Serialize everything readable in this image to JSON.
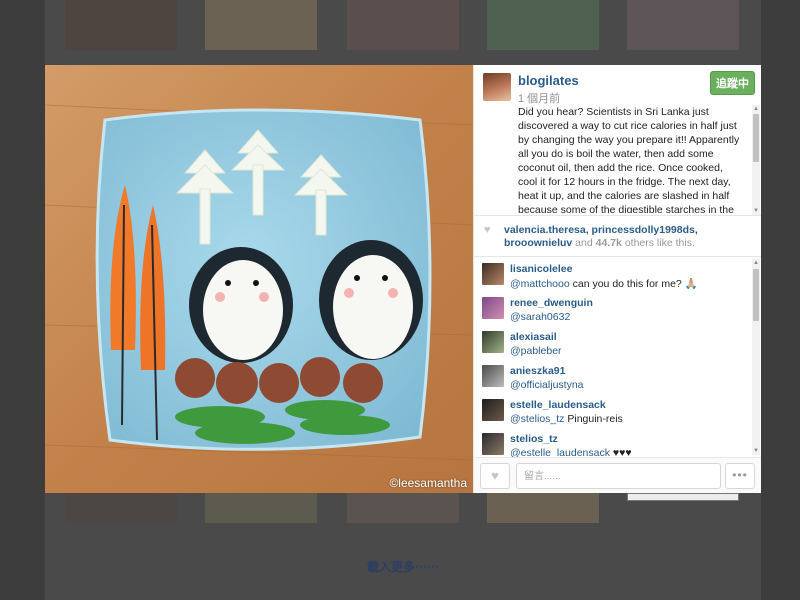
{
  "post": {
    "username": "blogilates",
    "time": "1 個月前",
    "follow_label": "追蹤中",
    "caption": "Did you hear? Scientists in Sri Lanka just discovered a way to cut rice calories in half just by changing the way you prepare it!! Apparently all you do is boil the water, then add some coconut oil, then add the rice. Once cooked, cool it for 12 hours in the fridge. The next day, heat it up, and the calories are slashed in half because some of the digestible starches in the rice have turned into resistant starches which are",
    "watermark": "©leesamantha"
  },
  "likes": {
    "names": "valencia.theresa, princessdolly1998ds, brooownieluv",
    "and_word": "and",
    "count": "44.7k",
    "suffix": "others like this."
  },
  "comments": [
    {
      "user": "lisanicolelee",
      "mention": "@mattchooo",
      "text": " can you do this for me? 🙏🏼"
    },
    {
      "user": "renee_dwenguin",
      "mention": "@sarah0632",
      "text": ""
    },
    {
      "user": "alexiasail",
      "mention": "@pableber",
      "text": ""
    },
    {
      "user": "anieszka91",
      "mention": "@officialjustyna",
      "text": ""
    },
    {
      "user": "estelle_laudensack",
      "mention": "@stelios_tz",
      "text": " Pinguin-reis"
    },
    {
      "user": "stelios_tz",
      "mention": "@estelle_laudensack",
      "text": " ♥♥♥"
    }
  ],
  "composer": {
    "placeholder": "留言......",
    "like_icon": "heart-icon",
    "more_label": "•••"
  },
  "footer": {
    "load_more": "載入更多⋯⋯"
  },
  "colors": {
    "link": "#2a5c8b",
    "follow_bg": "#6bb05c",
    "overlay": "#3d3d3d"
  }
}
